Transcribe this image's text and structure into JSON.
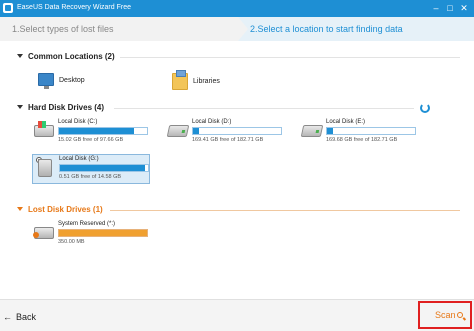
{
  "window": {
    "title": "EaseUS Data Recovery Wizard Free",
    "controls": {
      "minimize": "–",
      "maximize": "□",
      "close": "✕"
    }
  },
  "steps": {
    "step1": "1.Select types of lost files",
    "step2": "2.Select a location to start finding data"
  },
  "common_locations": {
    "header": "Common Locations (2)",
    "items": [
      {
        "label": "Desktop",
        "icon": "desktop-icon"
      },
      {
        "label": "Libraries",
        "icon": "libraries-icon"
      }
    ]
  },
  "hard_disk_drives": {
    "header": "Hard Disk Drives (4)",
    "drives": [
      {
        "name": "Local Disk (C:)",
        "free": "15.02 GB free of 97.66 GB",
        "used_fraction": 0.85,
        "icon": "windows-drive-icon"
      },
      {
        "name": "Local Disk (D:)",
        "free": "169.41 GB free of 182.71 GB",
        "used_fraction": 0.07,
        "icon": "hard-drive-icon"
      },
      {
        "name": "Local Disk (E:)",
        "free": "169.68 GB free of 182.71 GB",
        "used_fraction": 0.07,
        "icon": "hard-drive-icon"
      },
      {
        "name": "Local Disk (G:)",
        "free": "0.51 GB free of 14.58 GB",
        "used_fraction": 0.97,
        "icon": "usb-drive-icon",
        "selected": true
      }
    ]
  },
  "lost_disk_drives": {
    "header": "Lost Disk Drives (1)",
    "drives": [
      {
        "name": "System Reserved (*:)",
        "free": "350.00 MB",
        "used_fraction": 1.0,
        "icon": "lost-drive-icon"
      }
    ]
  },
  "footer": {
    "back_label": "Back",
    "back_arrow": "←",
    "scan_label": "Scan"
  },
  "colors": {
    "accent": "#1e8fd4",
    "lost": "#e77817",
    "scan_highlight": "#e02020"
  }
}
